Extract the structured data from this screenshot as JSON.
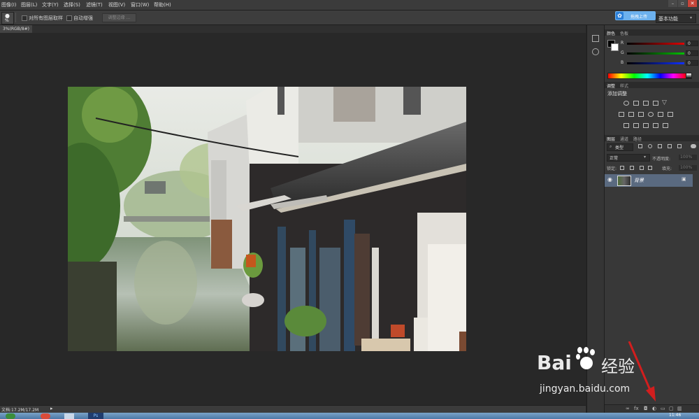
{
  "menu": [
    "图像(I)",
    "图层(L)",
    "文字(Y)",
    "选择(S)",
    "滤镜(T)",
    "视图(V)",
    "窗口(W)",
    "帮助(H)"
  ],
  "window_controls": [
    "–",
    "▫",
    "✕"
  ],
  "options": {
    "tool_preset": "%",
    "sample_all_layers": "对所有图层取样",
    "auto_enhance": "自动增强",
    "refine_edge": "调整边缘 ..."
  },
  "share_button": "拖拽上传",
  "workspace": "基本功能",
  "document_tab": "3%(RGB/8#)",
  "status": {
    "doc_size": "文档:17.2M/17.2M",
    "arrow": "▸"
  },
  "color_panel": {
    "tabs": [
      "颜色",
      "色板"
    ],
    "channels": [
      "R",
      "G",
      "B"
    ],
    "values": [
      "0",
      "0",
      "0"
    ]
  },
  "adjust_panel": {
    "tabs": [
      "调整",
      "样式"
    ],
    "title": "添加调整"
  },
  "layers_panel": {
    "tabs": [
      "图层",
      "通道",
      "路径"
    ],
    "filter_kind": "类型",
    "blend_mode": "正常",
    "opacity_label": "不透明度:",
    "opacity_value": "100%",
    "lock_label": "锁定:",
    "fill_label": "填充:",
    "fill_value": "100%",
    "layer_name": "背景"
  },
  "taskbar": {
    "clock": "11:46"
  },
  "watermark": {
    "brand": "Bai",
    "brand_cn": "经验",
    "url": "jingyan.baidu.com"
  },
  "colors": {
    "accent": "#2b7fd8",
    "panel": "#383838",
    "canvas": "#282828"
  },
  "icons": {
    "tool": "quick-selection-icon",
    "collapse": "double-arrow-icon",
    "visibility": "eye-icon",
    "lock": "lock-icon"
  }
}
